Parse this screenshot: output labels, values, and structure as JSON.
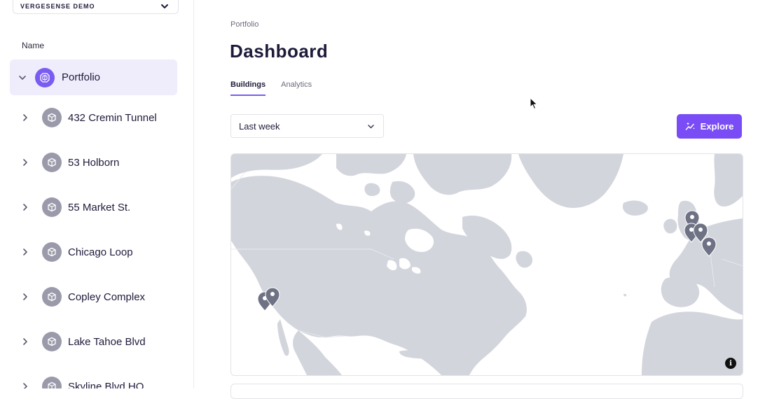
{
  "sidebar": {
    "org_name": "VERGESENSE DEMO",
    "column_header": "Name",
    "root": {
      "label": "Portfolio",
      "icon": "cubes-icon"
    },
    "items": [
      {
        "label": "432 Cremin Tunnel",
        "icon": "cube-icon"
      },
      {
        "label": "53 Holborn",
        "icon": "cube-icon"
      },
      {
        "label": "55 Market St.",
        "icon": "cube-icon"
      },
      {
        "label": "Chicago Loop",
        "icon": "cube-icon"
      },
      {
        "label": "Copley Complex",
        "icon": "cube-icon"
      },
      {
        "label": "Lake Tahoe Blvd",
        "icon": "cube-icon"
      },
      {
        "label": "Skyline Blvd HQ",
        "icon": "cube-icon"
      }
    ]
  },
  "main": {
    "breadcrumb": "Portfolio",
    "title": "Dashboard",
    "tabs": [
      {
        "label": "Buildings",
        "active": true
      },
      {
        "label": "Analytics",
        "active": false
      }
    ],
    "range": {
      "value": "Last week"
    },
    "explore_label": "Explore",
    "map_info": "i"
  },
  "colors": {
    "accent": "#7a4cf5",
    "selected_bg": "#efedfc",
    "land": "#d3d5dd",
    "marker": "#6e7284"
  }
}
